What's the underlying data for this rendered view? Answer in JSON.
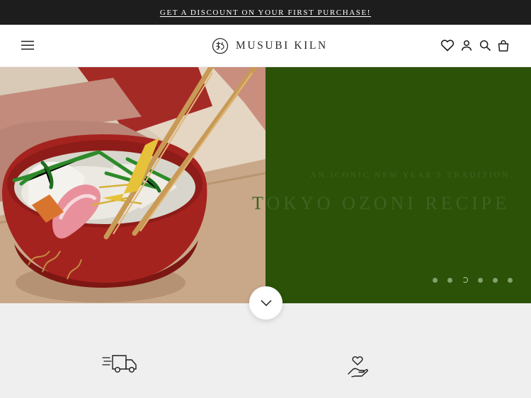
{
  "announcement": {
    "text": "GET A DISCOUNT ON YOUR FIRST PURCHASE!"
  },
  "header": {
    "brand": "MUSUBI KILN",
    "icons": [
      "menu-icon",
      "wishlist-heart-icon",
      "account-icon",
      "search-icon",
      "cart-bag-icon"
    ]
  },
  "hero": {
    "subtitle": "AN ICONIC NEW YEAR'S TRADITION",
    "title": "TOKYO OZONI RECIPE",
    "slide_count": 6,
    "active_slide": 3,
    "image": "ozoni soup in red lacquer bowl with chopsticks"
  },
  "features": {
    "icons": [
      "fast-delivery-truck-icon",
      "heart-in-hand-icon"
    ]
  },
  "colors": {
    "announcement_bg": "#1d1d1d",
    "hero_panel": "#2c5208",
    "hero_text": "#3d6321",
    "features_bg": "#efefef"
  }
}
